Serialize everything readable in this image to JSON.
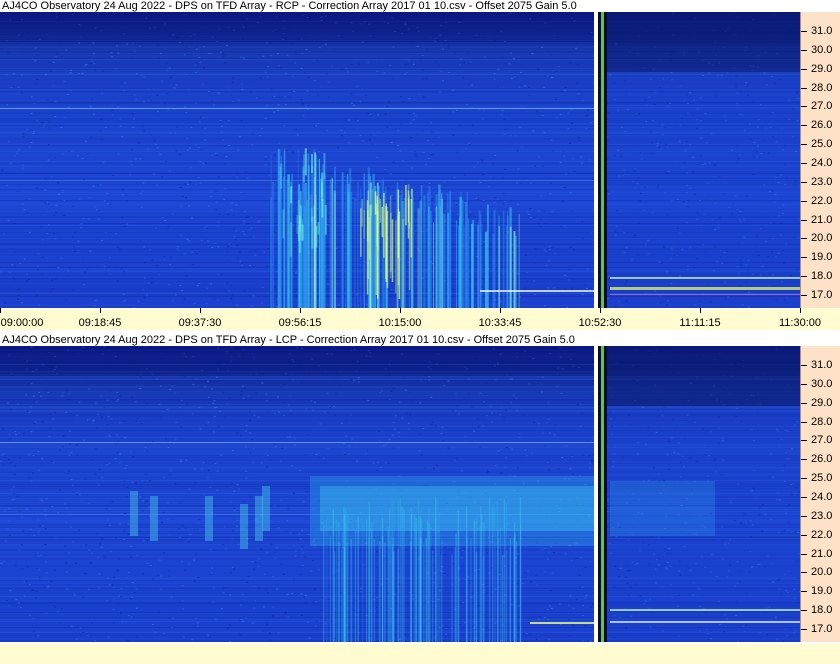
{
  "panels": [
    {
      "id": "rcp",
      "title": "AJ4CO Observatory 24 Aug 2022  -  DPS on TFD Array  -  RCP  -  Correction Array 2017 01 10.csv  -  Offset 2075  Gain 5.0",
      "polarization": "RCP",
      "freq_labels": [
        "31.0",
        "30.0",
        "29.0",
        "28.0",
        "27.0",
        "26.0",
        "25.0",
        "24.0",
        "23.0",
        "22.0",
        "21.0",
        "20.0",
        "19.0",
        "18.0",
        "17.0"
      ],
      "time_labels": [
        "09:00:00",
        "09:18:45",
        "09:37:30",
        "09:56:15",
        "10:15:00",
        "10:33:45",
        "10:52:30",
        "11:11:15",
        "11:30:00"
      ]
    },
    {
      "id": "lcp",
      "title": "AJ4CO Observatory 24 Aug 2022  -  DPS on TFD Array  -  LCP  -  Correction Array 2017 01 10.csv  -  Offset 2075  Gain 5.0",
      "polarization": "LCP",
      "freq_labels": [
        "31.0",
        "30.0",
        "29.0",
        "28.0",
        "27.0",
        "26.0",
        "25.0",
        "24.0",
        "23.0",
        "22.0",
        "21.0",
        "20.0",
        "19.0",
        "18.0",
        "17.0"
      ],
      "time_labels": []
    }
  ],
  "colors": {
    "background_blue": "#1a3fd0",
    "dark_band": "#0a1a80",
    "burst_cyan": "#40d8f0",
    "axis_peach": "#fde2c8",
    "axis_yellow": "#fefcd0"
  }
}
